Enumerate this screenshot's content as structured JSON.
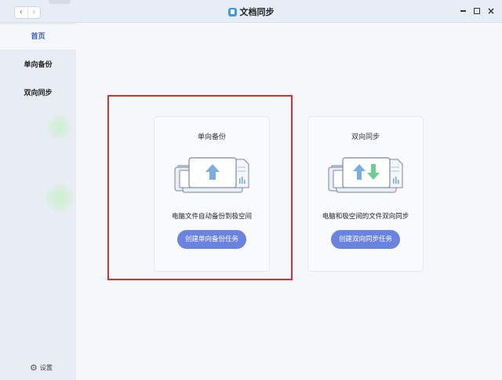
{
  "window": {
    "title": "文档同步",
    "nav": {
      "back_icon": "chevron-left-icon",
      "forward_icon": "chevron-right-icon"
    },
    "controls": {
      "minimize_icon": "minimize-icon",
      "maximize_icon": "maximize-icon",
      "close_icon": "close-icon"
    }
  },
  "sidebar": {
    "items": [
      {
        "label": "首页",
        "active": true
      },
      {
        "label": "单向备份",
        "active": false
      },
      {
        "label": "双向同步",
        "active": false
      }
    ],
    "settings_label": "设置",
    "settings_icon": "gear-icon"
  },
  "cards": [
    {
      "title": "单向备份",
      "description": "电脑文件自动备份到极空间",
      "button": "创建单向备份任务",
      "icon": "one-way-backup-illustration-icon"
    },
    {
      "title": "双向同步",
      "description": "电脑和极空间的文件双向同步",
      "button": "创建双向同步任务",
      "icon": "two-way-sync-illustration-icon"
    }
  ],
  "colors": {
    "accent": "#6b83e0",
    "active_nav": "#3d5fcb",
    "highlight": "#d93030",
    "up_arrow": "#7aaee0",
    "down_arrow": "#6dcf8f"
  }
}
